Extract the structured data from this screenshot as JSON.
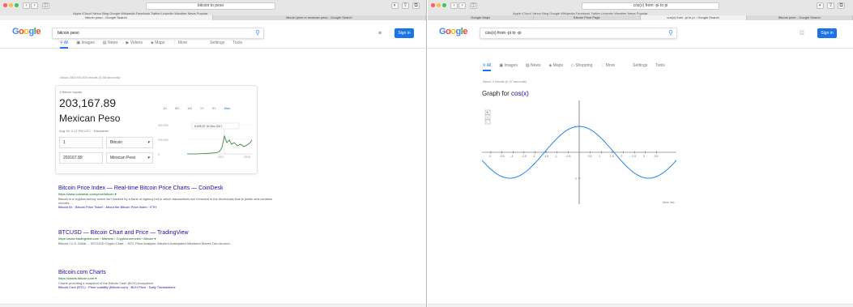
{
  "colors": {
    "accent": "#1a73e8",
    "link": "#1a0dab",
    "url": "#006621",
    "chart_line": "#1e88e5",
    "btc_line": "#2e7d32"
  },
  "left": {
    "window": {
      "url": "bitcoin to peso",
      "tabs": [
        "bitcoin peso - Google Search",
        "bitcoin price in mexican peso - Google Search"
      ],
      "bookmarks": "Apple iCloud Yahoo Bing Google Wikipedia Facebook Twitter LinkedIn Weather News Popular"
    },
    "search": {
      "logo": "Google",
      "query": "bitcoin peso",
      "signin": "Sign in"
    },
    "menu": [
      "All",
      "Images",
      "News",
      "Videos",
      "Maps",
      "More",
      "Settings",
      "Tools"
    ],
    "stats": "About 203,000,000 results (0.58 seconds)",
    "converter": {
      "label": "1 Bitcoin equals",
      "value": "203,167.89",
      "unit": "Mexican Peso",
      "date": "Aug 16, 2:17 PM UTC · Disclaimer",
      "ranges": [
        "1D",
        "5D",
        "1M",
        "1Y",
        "5Y",
        "Max"
      ],
      "amount": "1",
      "currency": "Bitcoin",
      "result": "203167.89",
      "result_currency": "Mexican Peso",
      "tooltip": "8,005.57  30 Nov 2017",
      "yticks": [
        "400,000",
        "200,000",
        "0"
      ],
      "xticks": [
        "2017",
        "2018"
      ]
    },
    "results": [
      {
        "title": "Bitcoin Price Index — Real-time Bitcoin Price Charts — CoinDesk",
        "url": "https://www.coindesk.com/price/bitcoin ▾",
        "snippet": "Bitcoin is a cryptocurrency which isn't backed by a bank or agency but in which transactions are recorded in the blockchain that is public and contains records ...",
        "links": "Bitcoin 5x · Bitcoin Price Ticker · About the Bitcoin Price Index · ETH"
      },
      {
        "title": "BTCUSD — Bitcoin Chart and Price — TradingView",
        "url": "https://www.tradingview.com › Markets › Cryptocurrencies › Bitcoin ▾",
        "snippet": "Bitcoin / U.S. Dollar ... BTCUSD Crypto Chart ... BTC Price Analysis: Bitcoin's Anticipated Weekend Moves Turn Around.",
        "links": ""
      },
      {
        "title": "Bitcoin.com Charts",
        "url": "https://charts.bitcoin.com ▾",
        "snippet": "Charts providing a snapshot of the Bitcoin Cash (BCH) ecosystem.",
        "links": "Bitcoin Core (BTC) · Price volatility (Bitcoin.com) · BCH Price · Daily Transactions"
      }
    ]
  },
  "right": {
    "window": {
      "url": "cos(x) from -pi to pi",
      "tabs": [
        "Google Maps",
        "Bitcoin Price Page",
        "cos(x) from -pi to pi - Google Search",
        "Bitcoin price - Google Search"
      ],
      "bookmarks": "Apple iCloud Yahoo Bing Google Wikipedia Facebook Twitter LinkedIn Weather News Popular"
    },
    "search": {
      "logo": "Google",
      "query": "cos(x) from -pi to -pi",
      "signin": "Sign in"
    },
    "menu": [
      "All",
      "Images",
      "News",
      "Maps",
      "Shopping",
      "More",
      "Settings",
      "Tools"
    ],
    "stats": "About 4 results (0.47 seconds)",
    "graph_title_prefix": "Graph for ",
    "graph_title_expr": "cos(x)",
    "more_info": "More info"
  },
  "chart_data": {
    "type": "line",
    "title": "Graph for cos(x)",
    "x": [
      -4,
      -3.5,
      -3,
      -2.5,
      -2,
      -1.5,
      -1,
      -0.5,
      0,
      0.5,
      1,
      1.5,
      2,
      2.5,
      3,
      3.5,
      4
    ],
    "series": [
      {
        "values": [
          -0.654,
          -0.936,
          -0.99,
          -0.801,
          -0.416,
          0.071,
          0.54,
          0.878,
          1,
          0.878,
          0.54,
          0.071,
          -0.416,
          -0.801,
          -0.99,
          -0.936,
          -0.654
        ]
      }
    ],
    "xticks": [
      "-4",
      "-3.5",
      "-3",
      "-2.5",
      "-2",
      "-1.5",
      "-1",
      "-0.5",
      "0.5",
      "1",
      "1.5",
      "2",
      "2.5",
      "3",
      "3.5"
    ],
    "yticks": [
      "1",
      "-1"
    ],
    "xlim": [
      -4.4,
      4.4
    ],
    "ylim": [
      -2,
      2
    ],
    "grid": false
  }
}
